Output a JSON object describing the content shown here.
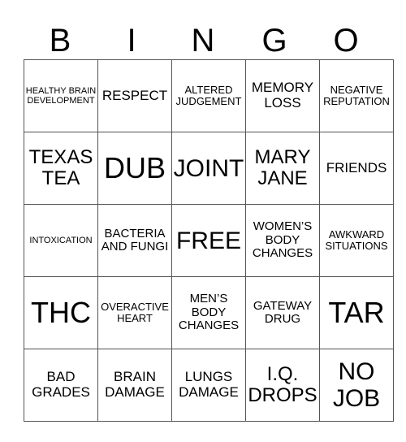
{
  "header": [
    "B",
    "I",
    "N",
    "G",
    "O"
  ],
  "rows": [
    [
      {
        "text": "HEALTHY BRAIN DEVELOPMENT",
        "size": "s1"
      },
      {
        "text": "RESPECT",
        "size": "s4"
      },
      {
        "text": "ALTERED JUDGEMENT",
        "size": "s2"
      },
      {
        "text": "MEMORY LOSS",
        "size": "s4"
      },
      {
        "text": "NEGATIVE REPUTATION",
        "size": "s2"
      }
    ],
    [
      {
        "text": "TEXAS TEA",
        "size": "s5"
      },
      {
        "text": "DUB",
        "size": "s7"
      },
      {
        "text": "JOINT",
        "size": "s6"
      },
      {
        "text": "MARY JANE",
        "size": "s5"
      },
      {
        "text": "FRIENDS",
        "size": "s4"
      }
    ],
    [
      {
        "text": "INTOXICATION",
        "size": "s1"
      },
      {
        "text": "BACTERIA AND FUNGI",
        "size": "s3"
      },
      {
        "text": "FREE",
        "size": "s6"
      },
      {
        "text": "WOMEN’S BODY CHANGES",
        "size": "s3"
      },
      {
        "text": "AWKWARD SITUATIONS",
        "size": "s2"
      }
    ],
    [
      {
        "text": "THC",
        "size": "s7"
      },
      {
        "text": "OVERACTIVE HEART",
        "size": "s2"
      },
      {
        "text": "MEN’S BODY CHANGES",
        "size": "s3"
      },
      {
        "text": "GATEWAY DRUG",
        "size": "s3"
      },
      {
        "text": "TAR",
        "size": "s7"
      }
    ],
    [
      {
        "text": "BAD GRADES",
        "size": "s4"
      },
      {
        "text": "BRAIN DAMAGE",
        "size": "s4"
      },
      {
        "text": "LUNGS DAMAGE",
        "size": "s4"
      },
      {
        "text": "I.Q. DROPS",
        "size": "s5"
      },
      {
        "text": "NO JOB",
        "size": "s6"
      }
    ]
  ]
}
